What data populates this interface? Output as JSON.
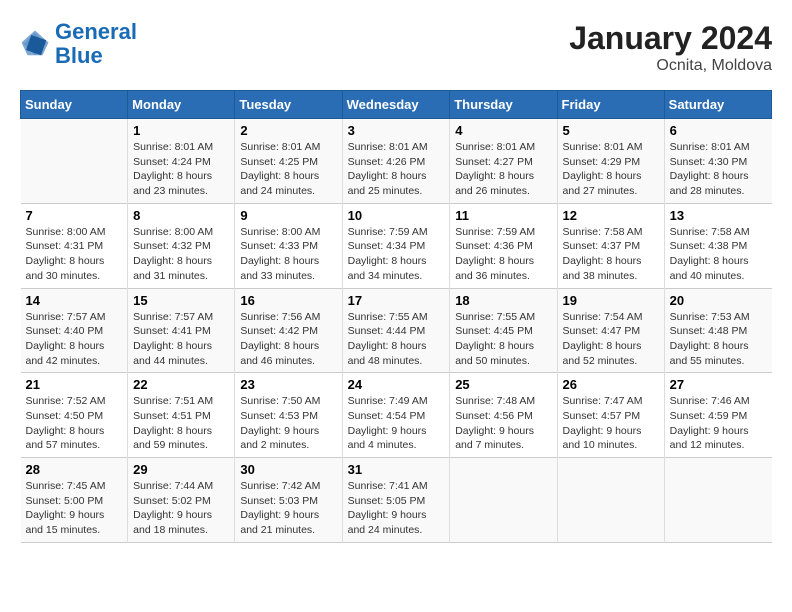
{
  "logo": {
    "text_general": "General",
    "text_blue": "Blue"
  },
  "title": "January 2024",
  "subtitle": "Ocnita, Moldova",
  "days_header": [
    "Sunday",
    "Monday",
    "Tuesday",
    "Wednesday",
    "Thursday",
    "Friday",
    "Saturday"
  ],
  "weeks": [
    [
      {
        "num": "",
        "sunrise": "",
        "sunset": "",
        "daylight": ""
      },
      {
        "num": "1",
        "sunrise": "Sunrise: 8:01 AM",
        "sunset": "Sunset: 4:24 PM",
        "daylight": "Daylight: 8 hours and 23 minutes."
      },
      {
        "num": "2",
        "sunrise": "Sunrise: 8:01 AM",
        "sunset": "Sunset: 4:25 PM",
        "daylight": "Daylight: 8 hours and 24 minutes."
      },
      {
        "num": "3",
        "sunrise": "Sunrise: 8:01 AM",
        "sunset": "Sunset: 4:26 PM",
        "daylight": "Daylight: 8 hours and 25 minutes."
      },
      {
        "num": "4",
        "sunrise": "Sunrise: 8:01 AM",
        "sunset": "Sunset: 4:27 PM",
        "daylight": "Daylight: 8 hours and 26 minutes."
      },
      {
        "num": "5",
        "sunrise": "Sunrise: 8:01 AM",
        "sunset": "Sunset: 4:29 PM",
        "daylight": "Daylight: 8 hours and 27 minutes."
      },
      {
        "num": "6",
        "sunrise": "Sunrise: 8:01 AM",
        "sunset": "Sunset: 4:30 PM",
        "daylight": "Daylight: 8 hours and 28 minutes."
      }
    ],
    [
      {
        "num": "7",
        "sunrise": "Sunrise: 8:00 AM",
        "sunset": "Sunset: 4:31 PM",
        "daylight": "Daylight: 8 hours and 30 minutes."
      },
      {
        "num": "8",
        "sunrise": "Sunrise: 8:00 AM",
        "sunset": "Sunset: 4:32 PM",
        "daylight": "Daylight: 8 hours and 31 minutes."
      },
      {
        "num": "9",
        "sunrise": "Sunrise: 8:00 AM",
        "sunset": "Sunset: 4:33 PM",
        "daylight": "Daylight: 8 hours and 33 minutes."
      },
      {
        "num": "10",
        "sunrise": "Sunrise: 7:59 AM",
        "sunset": "Sunset: 4:34 PM",
        "daylight": "Daylight: 8 hours and 34 minutes."
      },
      {
        "num": "11",
        "sunrise": "Sunrise: 7:59 AM",
        "sunset": "Sunset: 4:36 PM",
        "daylight": "Daylight: 8 hours and 36 minutes."
      },
      {
        "num": "12",
        "sunrise": "Sunrise: 7:58 AM",
        "sunset": "Sunset: 4:37 PM",
        "daylight": "Daylight: 8 hours and 38 minutes."
      },
      {
        "num": "13",
        "sunrise": "Sunrise: 7:58 AM",
        "sunset": "Sunset: 4:38 PM",
        "daylight": "Daylight: 8 hours and 40 minutes."
      }
    ],
    [
      {
        "num": "14",
        "sunrise": "Sunrise: 7:57 AM",
        "sunset": "Sunset: 4:40 PM",
        "daylight": "Daylight: 8 hours and 42 minutes."
      },
      {
        "num": "15",
        "sunrise": "Sunrise: 7:57 AM",
        "sunset": "Sunset: 4:41 PM",
        "daylight": "Daylight: 8 hours and 44 minutes."
      },
      {
        "num": "16",
        "sunrise": "Sunrise: 7:56 AM",
        "sunset": "Sunset: 4:42 PM",
        "daylight": "Daylight: 8 hours and 46 minutes."
      },
      {
        "num": "17",
        "sunrise": "Sunrise: 7:55 AM",
        "sunset": "Sunset: 4:44 PM",
        "daylight": "Daylight: 8 hours and 48 minutes."
      },
      {
        "num": "18",
        "sunrise": "Sunrise: 7:55 AM",
        "sunset": "Sunset: 4:45 PM",
        "daylight": "Daylight: 8 hours and 50 minutes."
      },
      {
        "num": "19",
        "sunrise": "Sunrise: 7:54 AM",
        "sunset": "Sunset: 4:47 PM",
        "daylight": "Daylight: 8 hours and 52 minutes."
      },
      {
        "num": "20",
        "sunrise": "Sunrise: 7:53 AM",
        "sunset": "Sunset: 4:48 PM",
        "daylight": "Daylight: 8 hours and 55 minutes."
      }
    ],
    [
      {
        "num": "21",
        "sunrise": "Sunrise: 7:52 AM",
        "sunset": "Sunset: 4:50 PM",
        "daylight": "Daylight: 8 hours and 57 minutes."
      },
      {
        "num": "22",
        "sunrise": "Sunrise: 7:51 AM",
        "sunset": "Sunset: 4:51 PM",
        "daylight": "Daylight: 8 hours and 59 minutes."
      },
      {
        "num": "23",
        "sunrise": "Sunrise: 7:50 AM",
        "sunset": "Sunset: 4:53 PM",
        "daylight": "Daylight: 9 hours and 2 minutes."
      },
      {
        "num": "24",
        "sunrise": "Sunrise: 7:49 AM",
        "sunset": "Sunset: 4:54 PM",
        "daylight": "Daylight: 9 hours and 4 minutes."
      },
      {
        "num": "25",
        "sunrise": "Sunrise: 7:48 AM",
        "sunset": "Sunset: 4:56 PM",
        "daylight": "Daylight: 9 hours and 7 minutes."
      },
      {
        "num": "26",
        "sunrise": "Sunrise: 7:47 AM",
        "sunset": "Sunset: 4:57 PM",
        "daylight": "Daylight: 9 hours and 10 minutes."
      },
      {
        "num": "27",
        "sunrise": "Sunrise: 7:46 AM",
        "sunset": "Sunset: 4:59 PM",
        "daylight": "Daylight: 9 hours and 12 minutes."
      }
    ],
    [
      {
        "num": "28",
        "sunrise": "Sunrise: 7:45 AM",
        "sunset": "Sunset: 5:00 PM",
        "daylight": "Daylight: 9 hours and 15 minutes."
      },
      {
        "num": "29",
        "sunrise": "Sunrise: 7:44 AM",
        "sunset": "Sunset: 5:02 PM",
        "daylight": "Daylight: 9 hours and 18 minutes."
      },
      {
        "num": "30",
        "sunrise": "Sunrise: 7:42 AM",
        "sunset": "Sunset: 5:03 PM",
        "daylight": "Daylight: 9 hours and 21 minutes."
      },
      {
        "num": "31",
        "sunrise": "Sunrise: 7:41 AM",
        "sunset": "Sunset: 5:05 PM",
        "daylight": "Daylight: 9 hours and 24 minutes."
      },
      {
        "num": "",
        "sunrise": "",
        "sunset": "",
        "daylight": ""
      },
      {
        "num": "",
        "sunrise": "",
        "sunset": "",
        "daylight": ""
      },
      {
        "num": "",
        "sunrise": "",
        "sunset": "",
        "daylight": ""
      }
    ]
  ]
}
